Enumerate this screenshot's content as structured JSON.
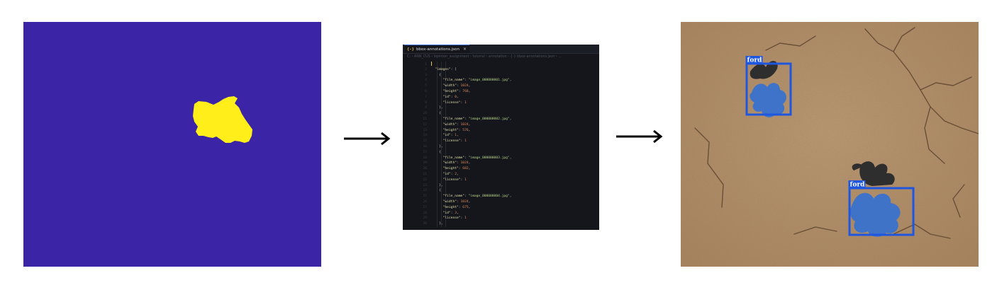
{
  "editor": {
    "tab_label": "bbox-annotations.json",
    "tab_close": "×",
    "tab_icon": "{-}",
    "breadcrumb": "C: › ANN_CUS › lopinton_assignment › tutorial › annotation › {-} bbox-annotations.json › ...",
    "code_lines": [
      {
        "num": "1",
        "tokens": [
          {
            "t": "cursor",
            "v": ""
          }
        ]
      },
      {
        "num": "2",
        "tokens": [
          {
            "t": "p",
            "v": "  "
          },
          {
            "t": "k",
            "v": "\"images\""
          },
          {
            "t": "p",
            "v": ": ["
          }
        ]
      },
      {
        "num": "3",
        "tokens": [
          {
            "t": "p",
            "v": "    {"
          }
        ]
      },
      {
        "num": "4",
        "tokens": [
          {
            "t": "p",
            "v": "      "
          },
          {
            "t": "k",
            "v": "\"file_name\""
          },
          {
            "t": "p",
            "v": ": "
          },
          {
            "t": "s",
            "v": "\"image_000000001.jpg\""
          },
          {
            "t": "p",
            "v": ","
          }
        ]
      },
      {
        "num": "5",
        "tokens": [
          {
            "t": "p",
            "v": "      "
          },
          {
            "t": "k",
            "v": "\"width\""
          },
          {
            "t": "p",
            "v": ": "
          },
          {
            "t": "n",
            "v": "1024"
          },
          {
            "t": "p",
            "v": ","
          }
        ]
      },
      {
        "num": "6",
        "tokens": [
          {
            "t": "p",
            "v": "      "
          },
          {
            "t": "k",
            "v": "\"height\""
          },
          {
            "t": "p",
            "v": ": "
          },
          {
            "t": "n",
            "v": "768"
          },
          {
            "t": "p",
            "v": ","
          }
        ]
      },
      {
        "num": "7",
        "tokens": [
          {
            "t": "p",
            "v": "      "
          },
          {
            "t": "k",
            "v": "\"id\""
          },
          {
            "t": "p",
            "v": ": "
          },
          {
            "t": "n",
            "v": "0"
          },
          {
            "t": "p",
            "v": ","
          }
        ]
      },
      {
        "num": "8",
        "tokens": [
          {
            "t": "p",
            "v": "      "
          },
          {
            "t": "k",
            "v": "\"license\""
          },
          {
            "t": "p",
            "v": ": "
          },
          {
            "t": "n",
            "v": "1"
          }
        ]
      },
      {
        "num": "9",
        "tokens": [
          {
            "t": "p",
            "v": "    },"
          }
        ]
      },
      {
        "num": "10",
        "tokens": [
          {
            "t": "p",
            "v": "    {"
          }
        ]
      },
      {
        "num": "11",
        "tokens": [
          {
            "t": "p",
            "v": "      "
          },
          {
            "t": "k",
            "v": "\"file_name\""
          },
          {
            "t": "p",
            "v": ": "
          },
          {
            "t": "s",
            "v": "\"image_000000002.jpg\""
          },
          {
            "t": "p",
            "v": ","
          }
        ]
      },
      {
        "num": "12",
        "tokens": [
          {
            "t": "p",
            "v": "      "
          },
          {
            "t": "k",
            "v": "\"width\""
          },
          {
            "t": "p",
            "v": ": "
          },
          {
            "t": "n",
            "v": "1024"
          },
          {
            "t": "p",
            "v": ","
          }
        ]
      },
      {
        "num": "13",
        "tokens": [
          {
            "t": "p",
            "v": "      "
          },
          {
            "t": "k",
            "v": "\"height\""
          },
          {
            "t": "p",
            "v": ": "
          },
          {
            "t": "n",
            "v": "576"
          },
          {
            "t": "p",
            "v": ","
          }
        ]
      },
      {
        "num": "14",
        "tokens": [
          {
            "t": "p",
            "v": "      "
          },
          {
            "t": "k",
            "v": "\"id\""
          },
          {
            "t": "p",
            "v": ": "
          },
          {
            "t": "n",
            "v": "1"
          },
          {
            "t": "p",
            "v": ","
          }
        ]
      },
      {
        "num": "15",
        "tokens": [
          {
            "t": "p",
            "v": "      "
          },
          {
            "t": "k",
            "v": "\"license\""
          },
          {
            "t": "p",
            "v": ": "
          },
          {
            "t": "n",
            "v": "1"
          }
        ]
      },
      {
        "num": "16",
        "tokens": [
          {
            "t": "p",
            "v": "    },"
          }
        ]
      },
      {
        "num": "17",
        "tokens": [
          {
            "t": "p",
            "v": "    {"
          }
        ]
      },
      {
        "num": "18",
        "tokens": [
          {
            "t": "p",
            "v": "      "
          },
          {
            "t": "k",
            "v": "\"file_name\""
          },
          {
            "t": "p",
            "v": ": "
          },
          {
            "t": "s",
            "v": "\"image_000000003.jpg\""
          },
          {
            "t": "p",
            "v": ","
          }
        ]
      },
      {
        "num": "19",
        "tokens": [
          {
            "t": "p",
            "v": "      "
          },
          {
            "t": "k",
            "v": "\"width\""
          },
          {
            "t": "p",
            "v": ": "
          },
          {
            "t": "n",
            "v": "1024"
          },
          {
            "t": "p",
            "v": ","
          }
        ]
      },
      {
        "num": "20",
        "tokens": [
          {
            "t": "p",
            "v": "      "
          },
          {
            "t": "k",
            "v": "\"height\""
          },
          {
            "t": "p",
            "v": ": "
          },
          {
            "t": "n",
            "v": "682"
          },
          {
            "t": "p",
            "v": ","
          }
        ]
      },
      {
        "num": "21",
        "tokens": [
          {
            "t": "p",
            "v": "      "
          },
          {
            "t": "k",
            "v": "\"id\""
          },
          {
            "t": "p",
            "v": ": "
          },
          {
            "t": "n",
            "v": "2"
          },
          {
            "t": "p",
            "v": ","
          }
        ]
      },
      {
        "num": "22",
        "tokens": [
          {
            "t": "p",
            "v": "      "
          },
          {
            "t": "k",
            "v": "\"license\""
          },
          {
            "t": "p",
            "v": ": "
          },
          {
            "t": "n",
            "v": "1"
          }
        ]
      },
      {
        "num": "23",
        "tokens": [
          {
            "t": "p",
            "v": "    },"
          }
        ]
      },
      {
        "num": "24",
        "tokens": [
          {
            "t": "p",
            "v": "    {"
          }
        ]
      },
      {
        "num": "25",
        "tokens": [
          {
            "t": "p",
            "v": "      "
          },
          {
            "t": "k",
            "v": "\"file_name\""
          },
          {
            "t": "p",
            "v": ": "
          },
          {
            "t": "s",
            "v": "\"image_000000004.jpg\""
          },
          {
            "t": "p",
            "v": ","
          }
        ]
      },
      {
        "num": "26",
        "tokens": [
          {
            "t": "p",
            "v": "      "
          },
          {
            "t": "k",
            "v": "\"width\""
          },
          {
            "t": "p",
            "v": ": "
          },
          {
            "t": "n",
            "v": "1024"
          },
          {
            "t": "p",
            "v": ","
          }
        ]
      },
      {
        "num": "27",
        "tokens": [
          {
            "t": "p",
            "v": "      "
          },
          {
            "t": "k",
            "v": "\"height\""
          },
          {
            "t": "p",
            "v": ": "
          },
          {
            "t": "n",
            "v": "675"
          },
          {
            "t": "p",
            "v": ","
          }
        ]
      },
      {
        "num": "28",
        "tokens": [
          {
            "t": "p",
            "v": "      "
          },
          {
            "t": "k",
            "v": "\"id\""
          },
          {
            "t": "p",
            "v": ": "
          },
          {
            "t": "n",
            "v": "3"
          },
          {
            "t": "p",
            "v": ","
          }
        ]
      },
      {
        "num": "29",
        "tokens": [
          {
            "t": "p",
            "v": "      "
          },
          {
            "t": "k",
            "v": "\"license\""
          },
          {
            "t": "p",
            "v": ": "
          },
          {
            "t": "n",
            "v": "1"
          }
        ]
      },
      {
        "num": "30",
        "tokens": [
          {
            "t": "p",
            "v": "    },"
          }
        ]
      }
    ]
  },
  "photo": {
    "detections": [
      {
        "label": "ford"
      },
      {
        "label": "ford"
      }
    ]
  },
  "colors": {
    "mask_background": "#3c24a6",
    "mask_foreground": "#ffee1a",
    "bbox": "#1e56e0",
    "soil": "#b48e68"
  },
  "icons": {
    "arrow": "right-arrow-icon",
    "close": "close-icon",
    "json_file": "json-file-icon"
  }
}
